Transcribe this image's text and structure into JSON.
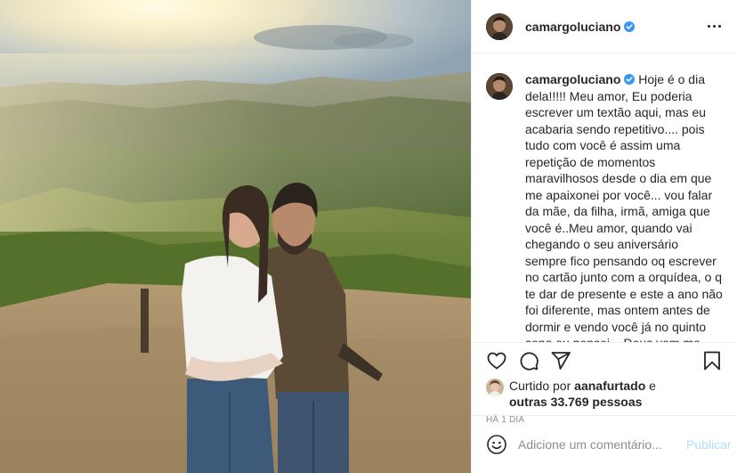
{
  "post": {
    "username": "camargoluciano",
    "verified": true,
    "more_icon": "more-horizontal-icon",
    "caption": "Hoje é o dia dela!!!!! Meu amor, Eu poderia escrever um textão aqui, mas eu acabaria sendo repetitivo.... pois tudo com você é assim uma repetição de momentos maravilhosos desde o dia em que me apaixonei por você... vou falar da mãe, da filha, irmã, amiga que você é..Meu amor, quando vai chegando o seu aniversário sempre fico pensando oq escrever no cartão junto com a orquídea, o q te dar de presente e este a ano não foi diferente, mas ontem antes de dormir e vendo você já no quinto sono eu pensei... Deus vem me atendendo e assim dando a você sempre os melhores presentes... naquele momento eu disse para mim mesmo,",
    "liked_prefix": "Curtido por",
    "liked_by": "aanafurtado",
    "liked_conjunction": "e",
    "liked_others": "outras 33.769 pessoas",
    "time_ago": "HÁ 1 DIA"
  },
  "actions": {
    "like_icon": "heart-icon",
    "comment_icon": "comment-icon",
    "share_icon": "share-icon",
    "save_icon": "bookmark-icon"
  },
  "comment_box": {
    "emoji_icon": "emoji-icon",
    "placeholder": "Adicione um comentário...",
    "publish_label": "Publicar"
  },
  "colors": {
    "verified": "#3897f0",
    "publish_disabled": "#b2dffc",
    "secondary_text": "#8e8e8e"
  }
}
